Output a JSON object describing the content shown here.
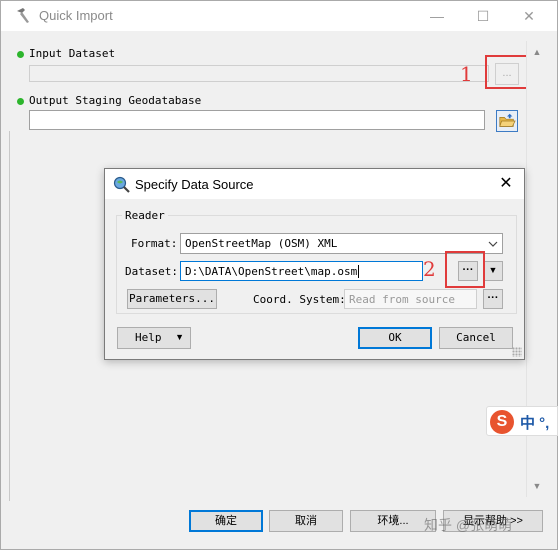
{
  "window": {
    "title": "Quick Import",
    "minimize_glyph": "—",
    "maximize_glyph": "☐",
    "close_glyph": "✕",
    "icon": "hammer-icon"
  },
  "form": {
    "input_dataset_label": "Input Dataset",
    "input_dataset_value": "",
    "input_browse_label": "...",
    "output_label": "Output Staging Geodatabase",
    "output_value": "",
    "output_browse_icon": "folder-open-icon"
  },
  "annotations": {
    "marker_1": "1",
    "marker_2": "2",
    "color": "#e03b3b"
  },
  "dialog": {
    "title": "Specify Data Source",
    "icon": "magnifier-icon",
    "close_glyph": "✕",
    "group_caption": "Reader",
    "format_label": "Format:",
    "format_value": "OpenStreetMap (OSM) XML",
    "dataset_label": "Dataset:",
    "dataset_value": "D:\\DATA\\OpenStreet\\map.osm",
    "dataset_browse_label": "···",
    "parameters_label": "Parameters...",
    "coord_label": "Coord. System:",
    "coord_placeholder": "Read from source",
    "coord_browse_label": "···",
    "help_label": "Help",
    "ok_label": "OK",
    "cancel_label": "Cancel"
  },
  "footer": {
    "ok_label": "确定",
    "cancel_label": "取消",
    "env_label": "环境...",
    "help_label": "显示帮助 >>"
  },
  "ime": {
    "logo": "S",
    "text": "中 °,"
  },
  "watermark": "知乎 @张萌萌",
  "colors": {
    "accent": "#0078d7",
    "status_dot": "#2db52d"
  }
}
